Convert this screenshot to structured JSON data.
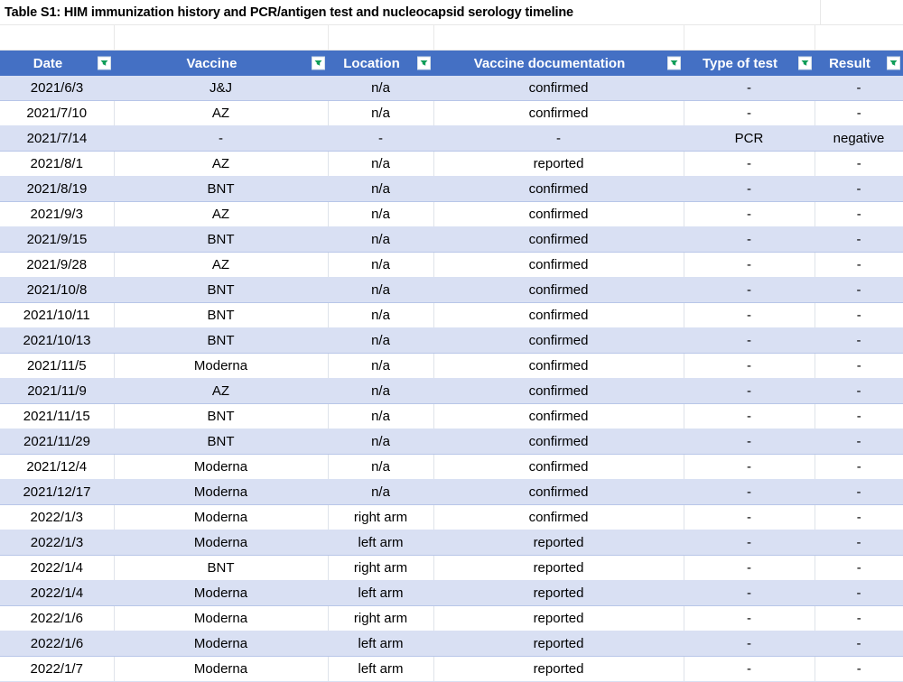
{
  "title": "Table S1: HIM immunization history and PCR/antigen test and nucleocapsid serology timeline",
  "colors": {
    "header_bg": "#4470c4",
    "header_text": "#ffffff",
    "band_bg": "#d9e0f3",
    "band_border": "#b8c6e8",
    "grid_line": "#dfe3ea",
    "filter_arrow": "#0f9d58"
  },
  "table": {
    "columns": [
      {
        "label": "Date",
        "filter_icon": "filter-dropdown-icon"
      },
      {
        "label": "Vaccine",
        "filter_icon": "filter-dropdown-icon"
      },
      {
        "label": "Location",
        "filter_icon": "filter-dropdown-icon"
      },
      {
        "label": "Vaccine documentation",
        "filter_icon": "filter-dropdown-icon"
      },
      {
        "label": "Type of test",
        "filter_icon": "filter-dropdown-icon"
      },
      {
        "label": "Result",
        "filter_icon": "filter-dropdown-icon"
      }
    ],
    "rows": [
      {
        "date": "2021/6/3",
        "vaccine": "J&J",
        "location": "n/a",
        "documentation": "confirmed",
        "type_of_test": "-",
        "result": "-"
      },
      {
        "date": "2021/7/10",
        "vaccine": "AZ",
        "location": "n/a",
        "documentation": "confirmed",
        "type_of_test": "-",
        "result": "-"
      },
      {
        "date": "2021/7/14",
        "vaccine": "-",
        "location": "-",
        "documentation": "-",
        "type_of_test": "PCR",
        "result": "negative"
      },
      {
        "date": "2021/8/1",
        "vaccine": "AZ",
        "location": "n/a",
        "documentation": "reported",
        "type_of_test": "-",
        "result": "-"
      },
      {
        "date": "2021/8/19",
        "vaccine": "BNT",
        "location": "n/a",
        "documentation": "confirmed",
        "type_of_test": "-",
        "result": "-"
      },
      {
        "date": "2021/9/3",
        "vaccine": "AZ",
        "location": "n/a",
        "documentation": "confirmed",
        "type_of_test": "-",
        "result": "-"
      },
      {
        "date": "2021/9/15",
        "vaccine": "BNT",
        "location": "n/a",
        "documentation": "confirmed",
        "type_of_test": "-",
        "result": "-"
      },
      {
        "date": "2021/9/28",
        "vaccine": "AZ",
        "location": "n/a",
        "documentation": "confirmed",
        "type_of_test": "-",
        "result": "-"
      },
      {
        "date": "2021/10/8",
        "vaccine": "BNT",
        "location": "n/a",
        "documentation": "confirmed",
        "type_of_test": "-",
        "result": "-"
      },
      {
        "date": "2021/10/11",
        "vaccine": "BNT",
        "location": "n/a",
        "documentation": "confirmed",
        "type_of_test": "-",
        "result": "-"
      },
      {
        "date": "2021/10/13",
        "vaccine": "BNT",
        "location": "n/a",
        "documentation": "confirmed",
        "type_of_test": "-",
        "result": "-"
      },
      {
        "date": "2021/11/5",
        "vaccine": "Moderna",
        "location": "n/a",
        "documentation": "confirmed",
        "type_of_test": "-",
        "result": "-"
      },
      {
        "date": "2021/11/9",
        "vaccine": "AZ",
        "location": "n/a",
        "documentation": "confirmed",
        "type_of_test": "-",
        "result": "-"
      },
      {
        "date": "2021/11/15",
        "vaccine": "BNT",
        "location": "n/a",
        "documentation": "confirmed",
        "type_of_test": "-",
        "result": "-"
      },
      {
        "date": "2021/11/29",
        "vaccine": "BNT",
        "location": "n/a",
        "documentation": "confirmed",
        "type_of_test": "-",
        "result": "-"
      },
      {
        "date": "2021/12/4",
        "vaccine": "Moderna",
        "location": "n/a",
        "documentation": "confirmed",
        "type_of_test": "-",
        "result": "-"
      },
      {
        "date": "2021/12/17",
        "vaccine": "Moderna",
        "location": "n/a",
        "documentation": "confirmed",
        "type_of_test": "-",
        "result": "-"
      },
      {
        "date": "2022/1/3",
        "vaccine": "Moderna",
        "location": "right arm",
        "documentation": "confirmed",
        "type_of_test": "-",
        "result": "-"
      },
      {
        "date": "2022/1/3",
        "vaccine": "Moderna",
        "location": "left arm",
        "documentation": "reported",
        "type_of_test": "-",
        "result": "-"
      },
      {
        "date": "2022/1/4",
        "vaccine": "BNT",
        "location": "right arm",
        "documentation": "reported",
        "type_of_test": "-",
        "result": "-"
      },
      {
        "date": "2022/1/4",
        "vaccine": "Moderna",
        "location": "left arm",
        "documentation": "reported",
        "type_of_test": "-",
        "result": "-"
      },
      {
        "date": "2022/1/6",
        "vaccine": "Moderna",
        "location": "right arm",
        "documentation": "reported",
        "type_of_test": "-",
        "result": "-"
      },
      {
        "date": "2022/1/6",
        "vaccine": "Moderna",
        "location": "left arm",
        "documentation": "reported",
        "type_of_test": "-",
        "result": "-"
      },
      {
        "date": "2022/1/7",
        "vaccine": "Moderna",
        "location": "left arm",
        "documentation": "reported",
        "type_of_test": "-",
        "result": "-"
      }
    ]
  }
}
